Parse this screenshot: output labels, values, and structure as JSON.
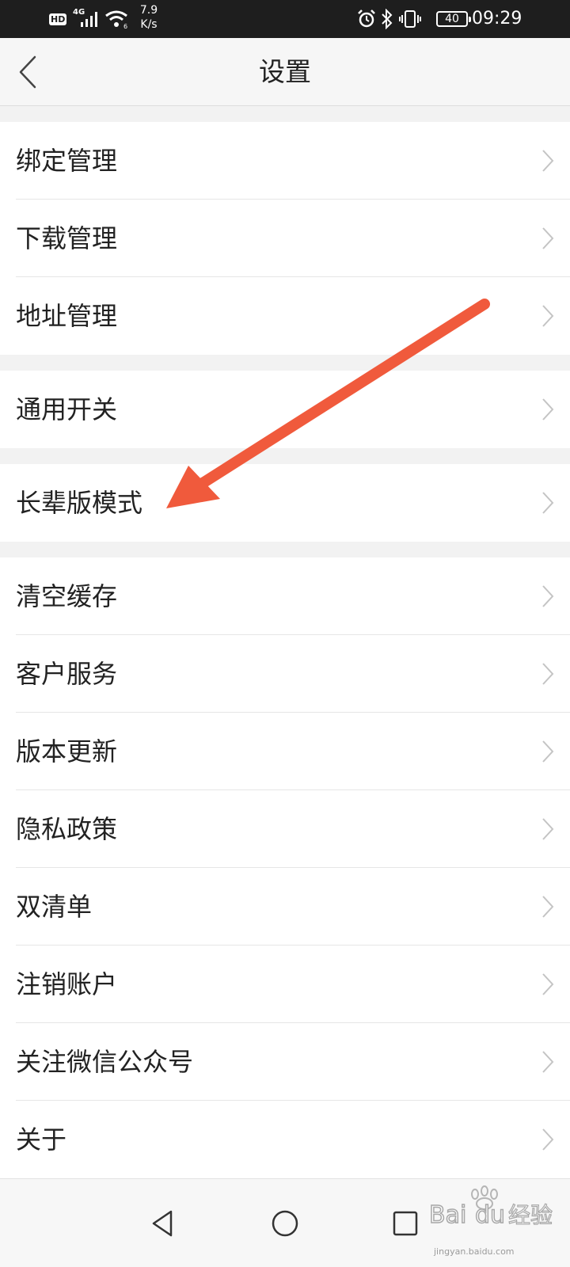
{
  "status_bar": {
    "hd": "HD",
    "network": "4G",
    "speed_value": "7.9",
    "speed_unit": "K/s",
    "battery": "40",
    "time": "09:29",
    "icons": [
      "signal-icon",
      "wifi-icon",
      "alarm-icon",
      "bluetooth-icon",
      "vibrate-icon"
    ]
  },
  "header": {
    "title": "设置",
    "back_icon": "chevron-left-icon"
  },
  "settings": {
    "group1": [
      "绑定管理",
      "下载管理",
      "地址管理"
    ],
    "group2": [
      "通用开关"
    ],
    "group3": [
      "长辈版模式"
    ],
    "group4": [
      "清空缓存",
      "客户服务",
      "版本更新",
      "隐私政策",
      "双清单",
      "注销账户",
      "关注微信公众号",
      "关于"
    ]
  },
  "annotation": {
    "color": "#f05a3c",
    "points_to": "长辈版模式"
  },
  "nav_bar": {
    "buttons": [
      "back-triangle-icon",
      "home-circle-icon",
      "recents-square-icon"
    ]
  },
  "watermark": {
    "logo": "Baidu经验",
    "url": "jingyan.baidu.com"
  }
}
